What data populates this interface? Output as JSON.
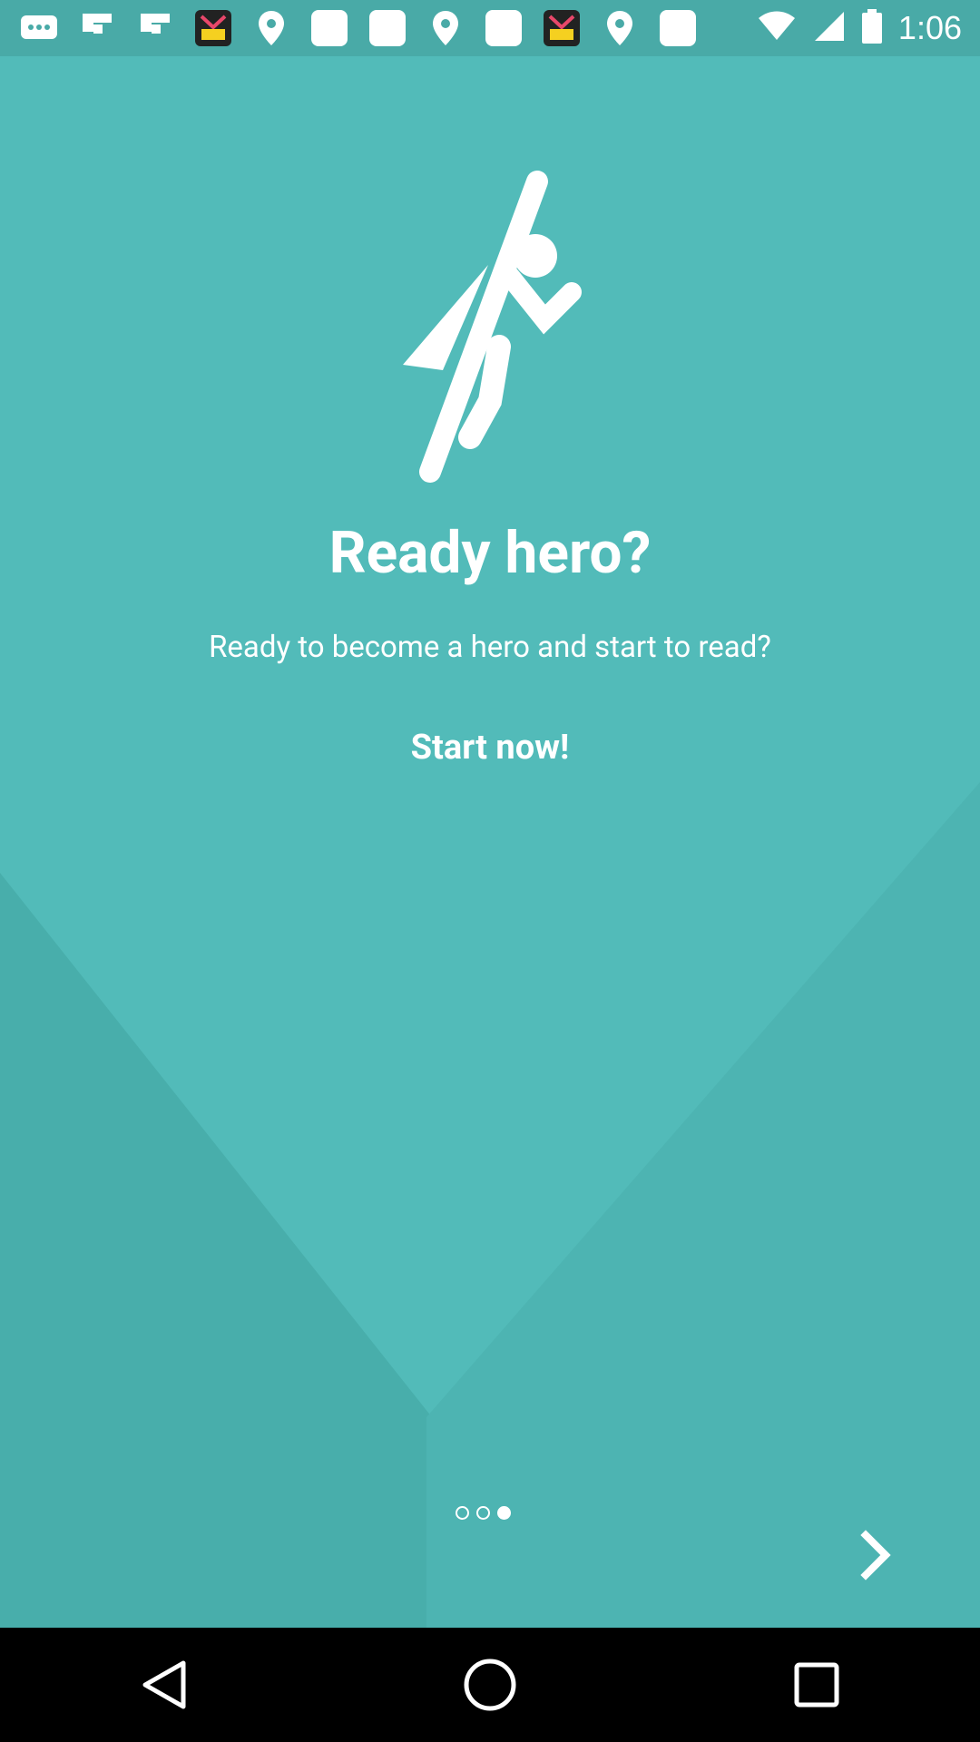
{
  "status_bar": {
    "time": "1:06",
    "icons": [
      "chat-bubble-icon",
      "flipboard-icon",
      "flipboard-icon",
      "pop-app-icon",
      "location-pin-icon",
      "square-icon",
      "square-icon",
      "location-pin-icon",
      "square-icon",
      "pop-app-icon",
      "location-pin-icon",
      "square-icon",
      "wifi-icon",
      "signal-icon",
      "battery-icon"
    ]
  },
  "onboarding": {
    "title": "Ready hero?",
    "subtitle": "Ready to become a hero and start to read?",
    "cta": "Start now!",
    "page_index": 3,
    "page_count": 3
  },
  "colors": {
    "background": "#52bbb9",
    "status_bar": "#49aaa7",
    "text": "#ffffff"
  },
  "nav": {
    "back": "back-triangle-icon",
    "home": "home-circle-icon",
    "recents": "recents-square-icon"
  }
}
